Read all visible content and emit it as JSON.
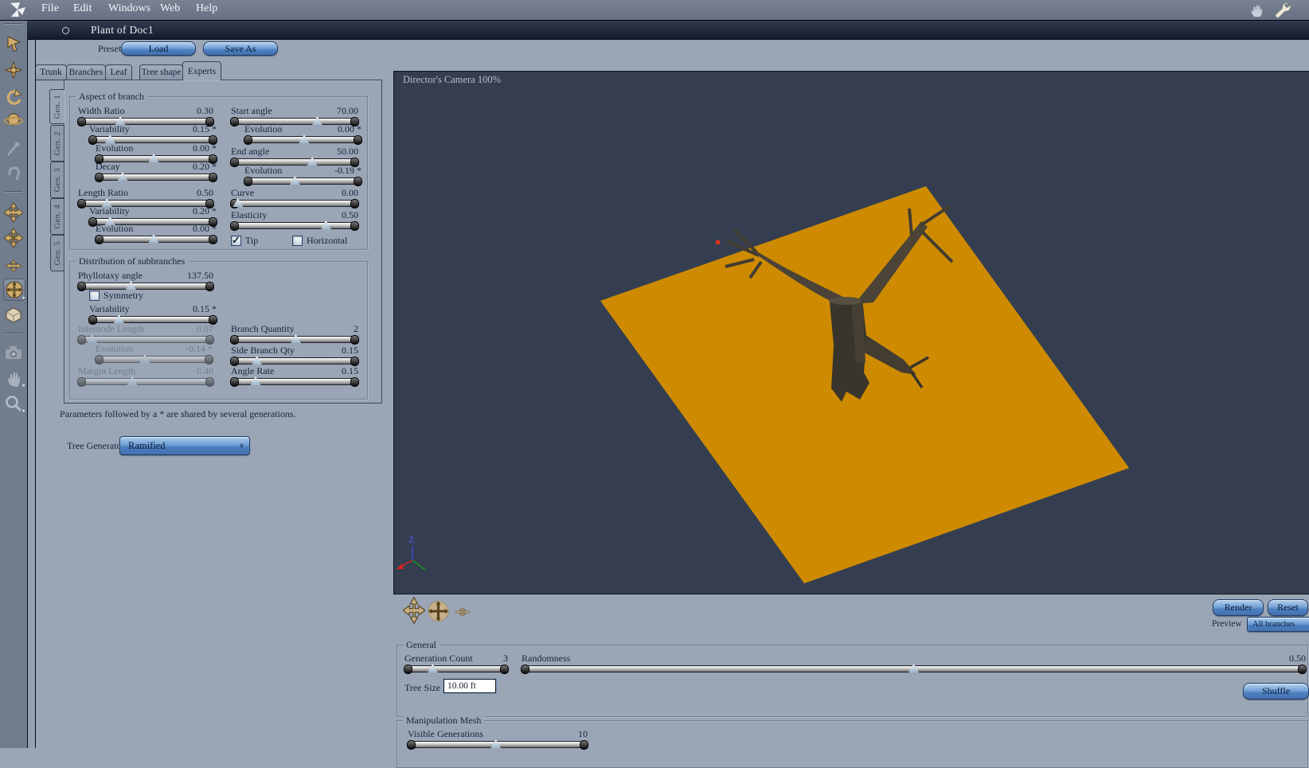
{
  "menubar": {
    "items": [
      "File",
      "Edit",
      "Windows",
      "Web",
      "Help"
    ]
  },
  "titlebar": {
    "title": "Plant of Doc1"
  },
  "preset": {
    "label": "Preset:",
    "load_label": "Load",
    "save_as_label": "Save As"
  },
  "tab_strip": {
    "tabs": [
      "Trunk",
      "Branches",
      "Leaf",
      "Tree shape",
      "Experts"
    ],
    "active_tab": "Experts"
  },
  "gen_tabs": [
    "Gen. 1",
    "Gen. 2",
    "Gen. 3",
    "Gen. 4",
    "Gen. 5"
  ],
  "aspect_of_branch": {
    "legend": "Aspect of branch",
    "width_ratio": {
      "label": "Width Ratio",
      "value": "0.30",
      "pos": 31
    },
    "width_variability": {
      "label": "Variability",
      "value": "0.15 *",
      "pos": 16
    },
    "width_evolution": {
      "label": "Evolution",
      "value": "0.00 *",
      "pos": 48
    },
    "decay": {
      "label": "Decay",
      "value": "0.20 *",
      "pos": 22
    },
    "length_ratio": {
      "label": "Length Ratio",
      "value": "0.50",
      "pos": 21
    },
    "length_variability": {
      "label": "Variability",
      "value": "0.20 *",
      "pos": 16
    },
    "length_evolution": {
      "label": "Evolution",
      "value": "0.00 *",
      "pos": 48
    },
    "start_angle": {
      "label": "Start angle",
      "value": "70.00",
      "pos": 68
    },
    "start_evolution": {
      "label": "Evolution",
      "value": "0.00 *",
      "pos": 51
    },
    "end_angle": {
      "label": "End angle",
      "value": "50.00",
      "pos": 64
    },
    "end_evolution": {
      "label": "Evolution",
      "value": "-0.19 *",
      "pos": 43
    },
    "curve": {
      "label": "Curve",
      "value": "0.00",
      "pos": 5
    },
    "elasticity": {
      "label": "Elasticity",
      "value": "0.50",
      "pos": 75
    },
    "tip": {
      "label": "Tip",
      "checked": true
    },
    "horizontal": {
      "label": "Horizontal",
      "checked": false
    }
  },
  "distribution": {
    "legend": "Distribution of subbranches",
    "phyllotaxy_angle": {
      "label": "Phyllotaxy angle",
      "value": "137.50",
      "pos": 39
    },
    "symmetry": {
      "label": "Symmetry",
      "checked": false
    },
    "variability": {
      "label": "Variability",
      "value": "0.15 *",
      "pos": 23
    },
    "internode_length": {
      "label": "Internode Length",
      "value": "0.07",
      "pos": 10,
      "disabled": true
    },
    "internode_evolution": {
      "label": "Evolution",
      "value": "-0.14 *",
      "pos": 42,
      "disabled": true
    },
    "margin_length": {
      "label": "Margin Length",
      "value": "0.40",
      "pos": 40,
      "disabled": true
    },
    "branch_quantity": {
      "label": "Branch Quantity",
      "value": "2",
      "pos": 51
    },
    "side_branch_qty": {
      "label": "Side Branch Qty",
      "value": "0.15",
      "pos": 20
    },
    "angle_rate": {
      "label": "Angle Rate",
      "value": "0.15",
      "pos": 19
    }
  },
  "footnote": "Parameters followed by a * are shared by several generations.",
  "tree_generator": {
    "label": "Tree Generator",
    "value": "Ramified"
  },
  "viewport": {
    "camera_label": "Director's Camera 100%",
    "axis_label": "Z"
  },
  "viewport_actions": {
    "render": "Render",
    "reset": "Reset",
    "preview_label": "Preview",
    "preview_value": "All branches"
  },
  "general": {
    "legend": "General",
    "generation_count": {
      "label": "Generation Count",
      "value": "3",
      "pos": 27
    },
    "randomness": {
      "label": "Randomness",
      "value": "0.50",
      "pos": 50
    },
    "tree_size": {
      "label": "Tree Size",
      "value": "10.00 ft"
    },
    "shuffle_label": "Shuffle"
  },
  "manipulation_mesh": {
    "legend": "Manipulation Mesh",
    "visible_generations": {
      "label": "Visible Generations",
      "value": "10",
      "pos": 49
    }
  },
  "icons": {
    "toolbar": [
      "select-arrow",
      "move-dart",
      "rotate",
      "scale-sphere",
      "eyedropper",
      "link-clip",
      "translate-xy",
      "translate-xz",
      "translate-plane",
      "trackball-rotate",
      "working-box",
      "camera",
      "hand-pan",
      "zoom"
    ],
    "viewport_nav": [
      "pan-tool",
      "trackball-tool",
      "plane-pan-tool"
    ],
    "menubar_right": [
      "hand-icon",
      "wrench-icon"
    ]
  },
  "colors": {
    "panel_bg": "#9aa5b6",
    "viewport_bg": "#343e50",
    "ground_plane": "#ce8b01",
    "button_accent": "#4f81c0",
    "titlebar_bg": "#1a2233"
  }
}
